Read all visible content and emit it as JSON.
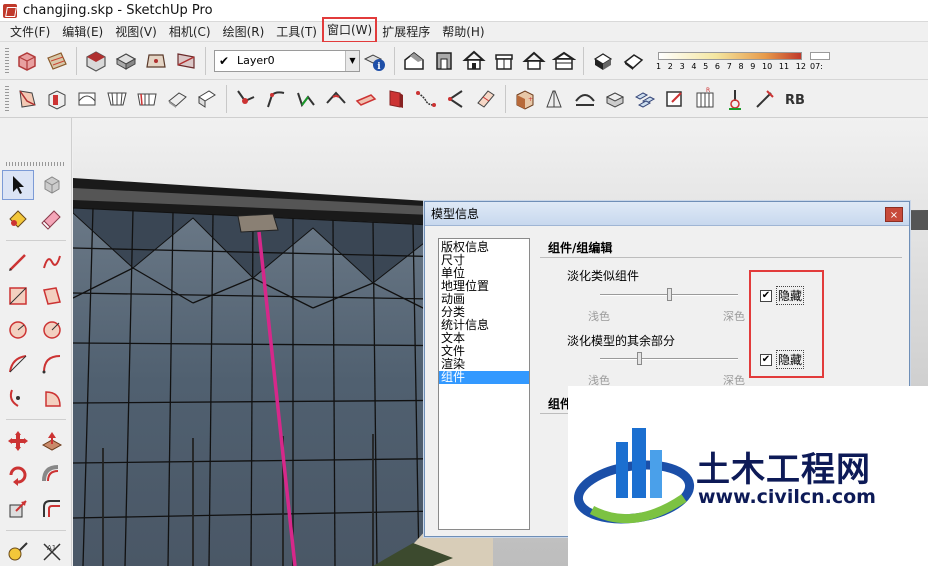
{
  "window": {
    "title": "changjing.skp - SketchUp Pro"
  },
  "menu": [
    {
      "label": "文件(F)"
    },
    {
      "label": "编辑(E)"
    },
    {
      "label": "视图(V)"
    },
    {
      "label": "相机(C)"
    },
    {
      "label": "绘图(R)"
    },
    {
      "label": "工具(T)"
    },
    {
      "label": "窗口(W)",
      "highlighted": true
    },
    {
      "label": "扩展程序"
    },
    {
      "label": "帮助(H)"
    }
  ],
  "layer_toolbar": {
    "current_layer": "Layer0",
    "checked": true
  },
  "fog_scale": {
    "ticks": [
      "1",
      "2",
      "3",
      "4",
      "5",
      "6",
      "7",
      "8",
      "9",
      "10",
      "11",
      "12"
    ],
    "extra_label": "07:"
  },
  "dialog": {
    "title": "模型信息",
    "close_label": "×",
    "categories": [
      {
        "label": "版权信息"
      },
      {
        "label": "尺寸"
      },
      {
        "label": "单位"
      },
      {
        "label": "地理位置"
      },
      {
        "label": "动画"
      },
      {
        "label": "分类"
      },
      {
        "label": "统计信息"
      },
      {
        "label": "文本"
      },
      {
        "label": "文件"
      },
      {
        "label": "渲染"
      },
      {
        "label": "组件",
        "selected": true
      }
    ],
    "section_title": "组件/组编辑",
    "section2_title": "组件",
    "fade_similar": {
      "label": "淡化类似组件",
      "level": 0.5,
      "light_label": "浅色",
      "dark_label": "深色",
      "hide_label": "隐藏",
      "hide_checked": true
    },
    "fade_rest": {
      "label": "淡化模型的其余部分",
      "level": 0.28,
      "light_label": "浅色",
      "dark_label": "深色",
      "hide_label": "隐藏",
      "hide_checked": true
    }
  },
  "watermark": {
    "name": "土木工程网",
    "url": "www.civilcn.com"
  },
  "colors": {
    "highlight_red": "#e23b3b",
    "selection_blue": "#3399ff",
    "axis_magenta": "#d6288a",
    "watermark_navy": "#0d1a57"
  }
}
